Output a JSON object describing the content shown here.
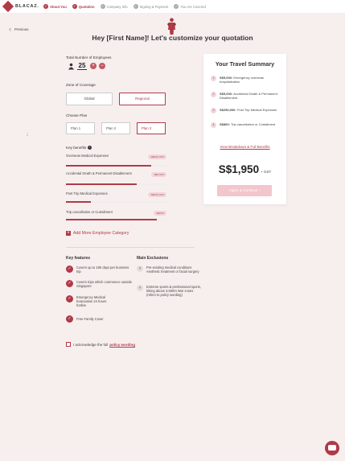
{
  "brand": {
    "name": "BLACAZ."
  },
  "colors": {
    "accent": "#b03a48",
    "accent_light": "#f2d6d9",
    "background": "#f7efee"
  },
  "steps": [
    {
      "label": "About You",
      "icon": "check-icon",
      "state": "done"
    },
    {
      "label": "Quotation",
      "icon": "check-icon",
      "state": "active"
    },
    {
      "label": "Company Info",
      "icon": "circle-icon",
      "state": "pending"
    },
    {
      "label": "Signing & Payment",
      "icon": "circle-icon",
      "state": "pending"
    },
    {
      "label": "You Are Covered",
      "icon": "circle-icon",
      "state": "pending"
    }
  ],
  "nav": {
    "back_label": "Previous"
  },
  "heading": "Hey [First Name]! Let's customize your quotation",
  "employees": {
    "label": "Total Number of Employees",
    "value": "25",
    "increment_icon": "plus-icon",
    "decrement_icon": "minus-icon"
  },
  "zone": {
    "label": "Zone of Coverage",
    "options": [
      "Global",
      "Regional"
    ],
    "selected": "Regional"
  },
  "plan": {
    "label": "Choose  Plan",
    "options": [
      "Plan 1",
      "Plan 2",
      "Plan 3"
    ],
    "selected": "Plan 3"
  },
  "benefits": {
    "label": "Key benefits",
    "items": [
      {
        "name": "Overseas Medical Expenses",
        "tag": "S$XXX,XXX",
        "level": 0.85
      },
      {
        "name": "Accidental Death & Permanent Disablement",
        "tag": "S$X,XXX",
        "level": 0.7
      },
      {
        "name": "Post Trip Medical Expenses",
        "tag": "S$XXX,XXX",
        "level": 0.25
      },
      {
        "name": "Trip cancellation or Curtailment",
        "tag": "S$XXX",
        "level": 0.9
      }
    ]
  },
  "add_category": "Add More Employee Category",
  "key_features": {
    "title": "Key features",
    "items": [
      "Covers up to 180 days per business trip",
      "Covers trips which commence outside Singapore",
      "Emergency Medical Evacuation 24 hours hotline",
      "Free Family Cover"
    ]
  },
  "exclusions": {
    "title": "Main Exclusions",
    "items": [
      "Pre-existing medical conditions Aesthetic treatment or facial surgery",
      "Extreme sports & professional sports, hiking above 3,500m War zones (refers to policy wording)"
    ]
  },
  "acknowledge": {
    "text": "I acknowledge the full",
    "link": "policy wording"
  },
  "summary": {
    "title": "Your Travel Summary",
    "items": [
      {
        "amount": "S$5,000:",
        "text": "Emergency overseas hospitalization"
      },
      {
        "amount": "S$5,000:",
        "text": "Accidental Death & Permanent Disablement"
      },
      {
        "amount": "S$250,000:",
        "text": "Post Trip Medical Expenses"
      },
      {
        "amount": "S$800:",
        "text": "Trip cancellation or Curtailment"
      }
    ],
    "breakdown_link": "View Breakdown & Full Benefits",
    "price": "S$1,950",
    "price_suffix": "+ GST",
    "proceed_label": "Agree & Continue"
  },
  "chat": {
    "icon": "chat-icon"
  }
}
